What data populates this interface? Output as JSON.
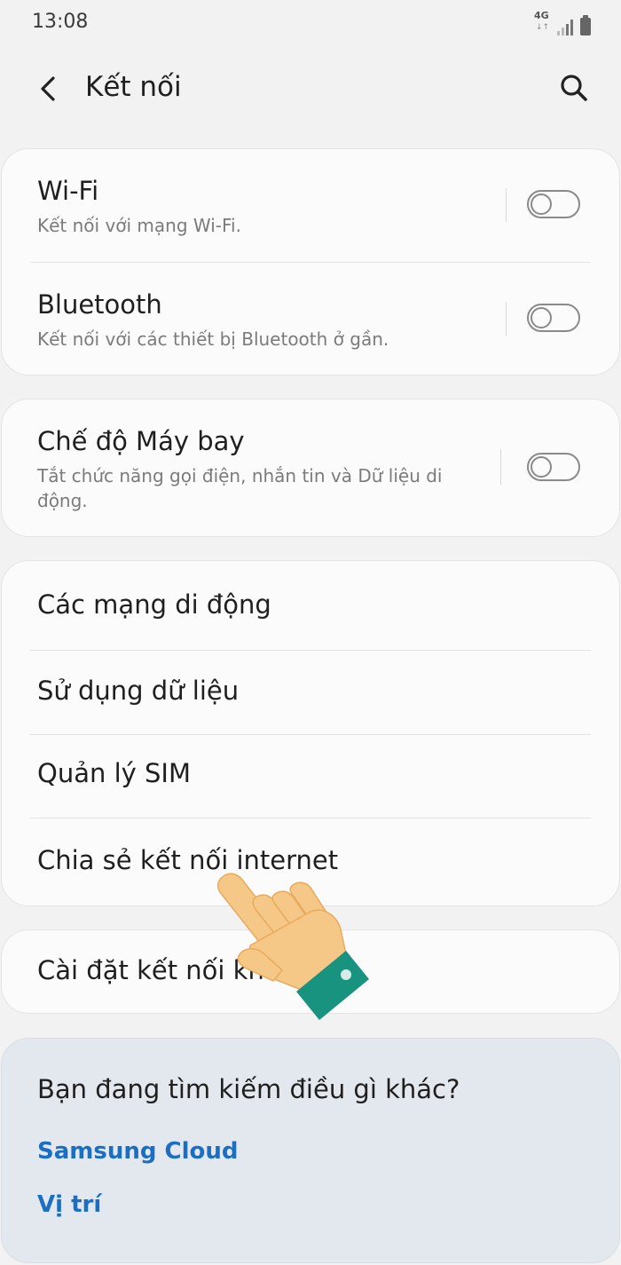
{
  "status_bar": {
    "time": "13:08",
    "network_type": "4G",
    "icons": [
      "data-arrows-icon",
      "signal-icon",
      "battery-icon"
    ]
  },
  "app_bar": {
    "title": "Kết nối",
    "back_icon": "back-icon",
    "search_icon": "search-icon"
  },
  "groups": {
    "wireless": [
      {
        "title": "Wi-Fi",
        "subtitle": "Kết nối với mạng Wi-Fi.",
        "toggle": "off"
      },
      {
        "title": "Bluetooth",
        "subtitle": "Kết nối với các thiết bị Bluetooth ở gần.",
        "toggle": "off"
      }
    ],
    "airplane": {
      "title": "Chế độ Máy bay",
      "subtitle": "Tắt chức năng gọi điện, nhắn tin và Dữ liệu di động.",
      "toggle": "off"
    },
    "network": [
      {
        "title": "Các mạng di động"
      },
      {
        "title": "Sử dụng dữ liệu"
      },
      {
        "title": "Quản lý SIM"
      },
      {
        "title": "Chia sẻ kết nối internet"
      }
    ],
    "more": {
      "title": "Cài đặt kết nối khác"
    }
  },
  "suggestions": {
    "title": "Bạn đang tìm kiếm điều gì khác?",
    "links": [
      "Samsung Cloud",
      "Vị trí"
    ]
  },
  "colors": {
    "background": "#f2f2f2",
    "card": "#fbfbfb",
    "suggestion_card": "#e3e8ef",
    "link": "#1a6fc2",
    "hand_skin": "#f6c888",
    "hand_sleeve": "#17937f"
  },
  "overlay": {
    "pointer": "pointing-hand-icon"
  }
}
